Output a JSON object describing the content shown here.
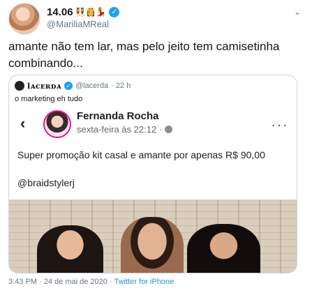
{
  "author": {
    "display_name": "14.06",
    "emoji": "👯👸💃",
    "handle": "@MariliaMReal"
  },
  "tweet": {
    "text": "amante não tem lar, mas pelo jeito tem camisetinha combinando..."
  },
  "quoted": {
    "display_name": "lᴀcᴇʀᴅᴀ",
    "handle": "@lacerda",
    "time": "· 22 h",
    "text": "o marketing eh tudo",
    "facebook_post": {
      "back_icon": "‹",
      "name": "Fernanda Rocha",
      "time": "sexta-feira às 22:12 ·",
      "more_icon": "···",
      "text": "Super promoção kit casal e amante por apenas R$ 90,00",
      "tag": "@braidstylerj"
    }
  },
  "footer": {
    "time": "3:43 PM · 24 de mai de 2020 ·",
    "source": "Twitter for iPhone"
  },
  "icons": {
    "verified": "✓",
    "caret": "⌄"
  },
  "colors": {
    "verified": "#1da1f2",
    "secondary_text": "#657786",
    "link": "#1b95e0"
  }
}
